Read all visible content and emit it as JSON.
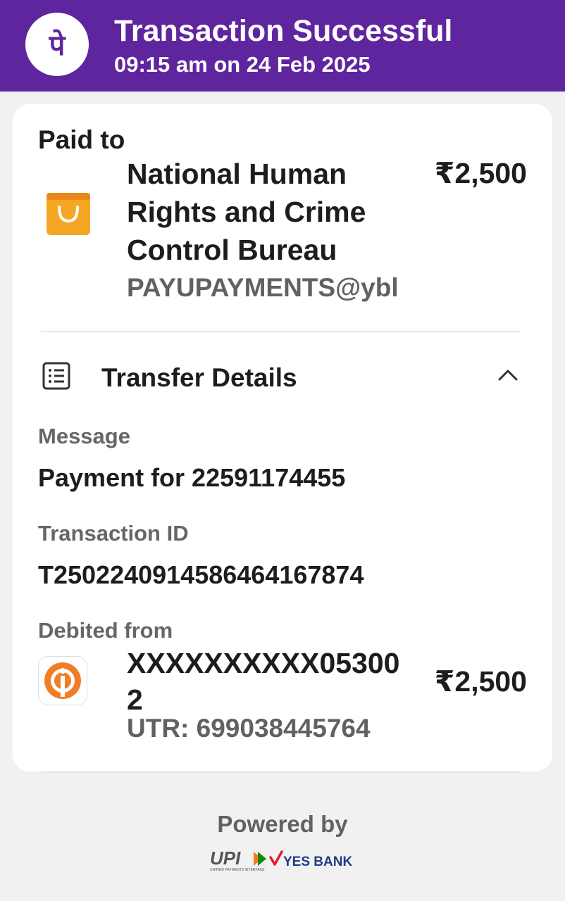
{
  "header": {
    "title": "Transaction Successful",
    "datetime": "09:15 am on 24 Feb 2025",
    "logo_glyph": "पे",
    "bg_color": "#5f259f"
  },
  "paid_to": {
    "label": "Paid to",
    "merchant_name": "National Human Rights and Crime Control Bureau",
    "vpa": "PAYUPAYMENTS@ybl",
    "amount": "₹2,500",
    "icon": "shopping-bag-icon"
  },
  "transfer_details": {
    "label": "Transfer Details",
    "icon": "receipt-list-icon",
    "toggle_icon": "chevron-up-icon",
    "message_label": "Message",
    "message_value": "Payment for 22591174455",
    "transaction_id_label": "Transaction ID",
    "transaction_id_value": "T2502240914586464167874",
    "debited_from_label": "Debited from",
    "account": "XXXXXXXXXX053002",
    "amount": "₹2,500",
    "utr": "UTR: 699038445764",
    "bank_icon": "bank-logo-icon"
  },
  "footer": {
    "powered_by": "Powered by",
    "upi_text": "UPI",
    "upi_tagline": "UNIFIED PAYMENTS INTERFACE",
    "bank_name": "YES BANK"
  }
}
